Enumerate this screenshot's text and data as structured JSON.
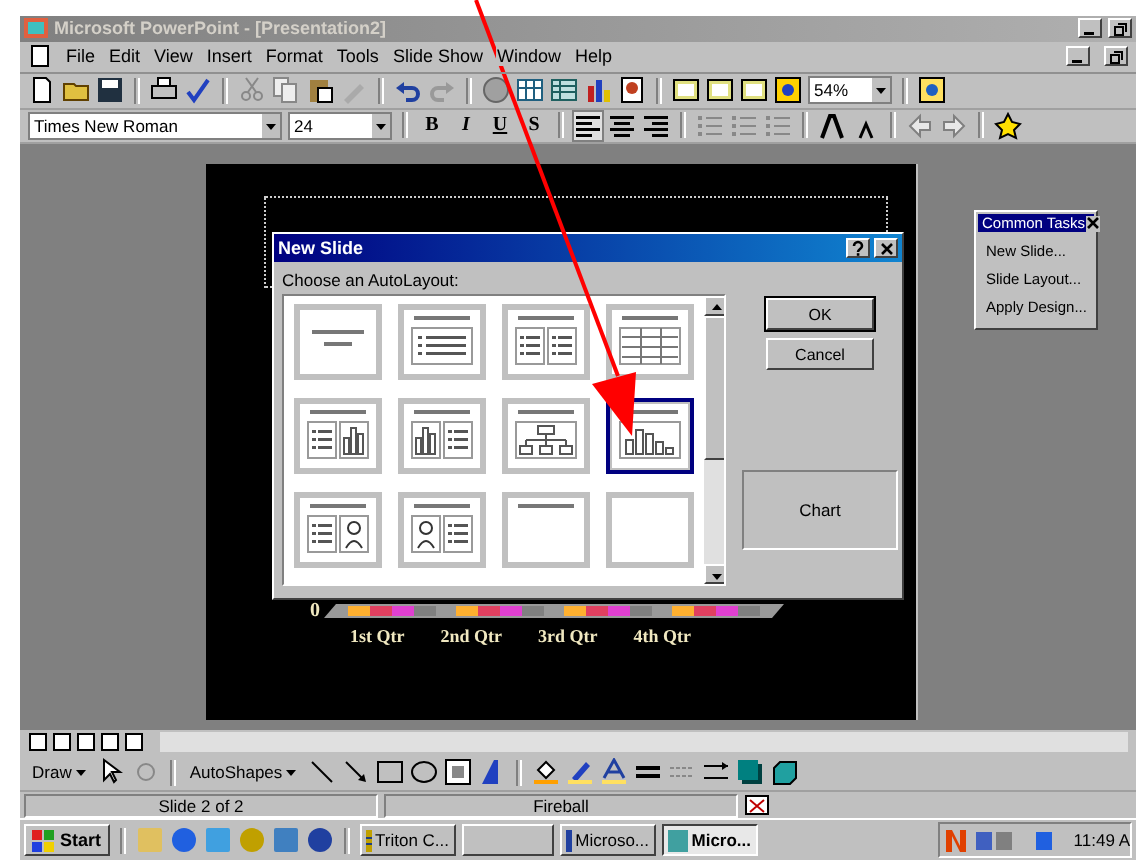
{
  "window": {
    "title": "Microsoft PowerPoint - [Presentation2]"
  },
  "menu": [
    "File",
    "Edit",
    "View",
    "Insert",
    "Format",
    "Tools",
    "Slide Show",
    "Window",
    "Help"
  ],
  "formatting": {
    "font": "Times New Roman",
    "size": "24",
    "zoom": "54%",
    "style_buttons": [
      "B",
      "I",
      "U",
      "S"
    ]
  },
  "slide": {
    "axis_zero": "0",
    "categories": [
      "1st Qtr",
      "2nd Qtr",
      "3rd Qtr",
      "4th Qtr"
    ]
  },
  "dialog": {
    "title": "New Slide",
    "prompt": "Choose an AutoLayout:",
    "buttons": [
      "OK",
      "Cancel"
    ],
    "preview": "Chart",
    "layouts": [
      {
        "kind": "title",
        "selected": false
      },
      {
        "kind": "bullets",
        "selected": false
      },
      {
        "kind": "two-column",
        "selected": false
      },
      {
        "kind": "table",
        "selected": false
      },
      {
        "kind": "text-chart",
        "selected": false
      },
      {
        "kind": "chart-text",
        "selected": false
      },
      {
        "kind": "org",
        "selected": false
      },
      {
        "kind": "chart",
        "selected": true
      },
      {
        "kind": "text-clipart",
        "selected": false
      },
      {
        "kind": "clipart-text",
        "selected": false
      },
      {
        "kind": "title-only",
        "selected": false
      },
      {
        "kind": "blank",
        "selected": false
      }
    ]
  },
  "common_tasks": {
    "title": "Common Tasks",
    "items": [
      "New Slide...",
      "Slide Layout...",
      "Apply Design..."
    ]
  },
  "drawing_toolbar": {
    "draw": "Draw",
    "autoshapes": "AutoShapes"
  },
  "status_bar": {
    "slide": "Slide 2 of 2",
    "design": "Fireball"
  },
  "taskbar": {
    "start": "Start",
    "tasks": [
      {
        "label": "Triton C...",
        "selected": false
      },
      {
        "label": "Microso...",
        "selected": false
      },
      {
        "label": "Micro...",
        "selected": true
      }
    ],
    "clock": "11:49 A"
  }
}
